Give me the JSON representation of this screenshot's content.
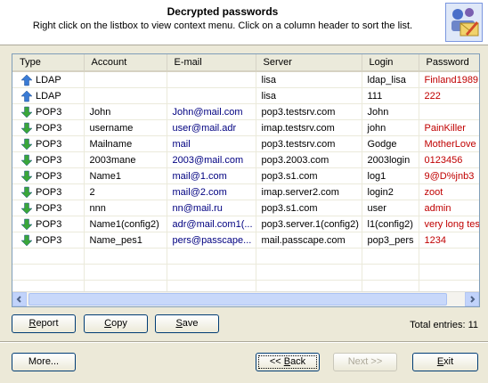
{
  "header": {
    "title": "Decrypted passwords",
    "subtitle": "Right click on the listbox to view context menu. Click on a column header to sort the list."
  },
  "table": {
    "columns": [
      "Type",
      "Account",
      "E-mail",
      "Server",
      "Login",
      "Password"
    ],
    "rows": [
      {
        "type": "LDAP",
        "direction": "up",
        "account": "",
        "email": "",
        "server": "lisa",
        "login": "ldap_lisa",
        "password": "Finland1989"
      },
      {
        "type": "LDAP",
        "direction": "up",
        "account": "",
        "email": "",
        "server": "lisa",
        "login": "111",
        "password": "222"
      },
      {
        "type": "POP3",
        "direction": "down",
        "account": "John",
        "email": "John@mail.com",
        "server": "pop3.testsrv.com",
        "login": "John",
        "password": ""
      },
      {
        "type": "POP3",
        "direction": "down",
        "account": "username",
        "email": "user@mail.adr",
        "server": "imap.testsrv.com",
        "login": "john",
        "password": "PainKiller"
      },
      {
        "type": "POP3",
        "direction": "down",
        "account": "Mailname",
        "email": "mail",
        "server": "pop3.testsrv.com",
        "login": "Godge",
        "password": "MotherLove"
      },
      {
        "type": "POP3",
        "direction": "down",
        "account": "2003mane",
        "email": "2003@mail.com",
        "server": "pop3.2003.com",
        "login": "2003login",
        "password": "0123456"
      },
      {
        "type": "POP3",
        "direction": "down",
        "account": "Name1",
        "email": "mail@1.com",
        "server": "pop3.s1.com",
        "login": "log1",
        "password": "9@D%jnb3"
      },
      {
        "type": "POP3",
        "direction": "down",
        "account": "2",
        "email": "mail@2.com",
        "server": "imap.server2.com",
        "login": "login2",
        "password": "zoot"
      },
      {
        "type": "POP3",
        "direction": "down",
        "account": "nnn",
        "email": "nn@mail.ru",
        "server": "pop3.s1.com",
        "login": "user",
        "password": "admin"
      },
      {
        "type": "POP3",
        "direction": "down",
        "account": "Name1(config2)",
        "email": "adr@mail.com1(...",
        "server": "pop3.server.1(config2)",
        "login": "l1(config2)",
        "password": "very long test"
      },
      {
        "type": "POP3",
        "direction": "down",
        "account": "Name_pes1",
        "email": "pers@passcape...",
        "server": "mail.passcape.com",
        "login": "pop3_pers",
        "password": "1234"
      }
    ]
  },
  "buttons": {
    "report": {
      "underline": "R",
      "rest": "eport"
    },
    "copy": {
      "underline": "C",
      "rest": "opy"
    },
    "save": {
      "underline": "S",
      "rest": "ave"
    },
    "more": "More...",
    "back": {
      "pre": "<< ",
      "underline": "B",
      "rest": "ack"
    },
    "next": "Next >>",
    "exit": {
      "underline": "E",
      "rest": "xit"
    }
  },
  "status": {
    "total_entries": "Total entries: 11"
  },
  "colors": {
    "email": "#000080",
    "password": "#c00000",
    "up_arrow": "#3a7bd5",
    "down_arrow": "#3aa63a"
  }
}
